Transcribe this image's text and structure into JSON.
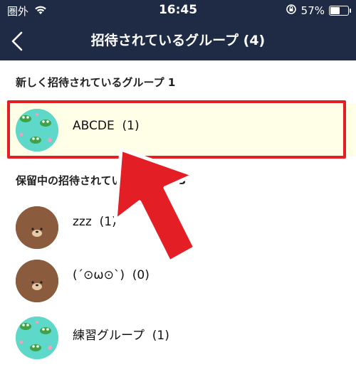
{
  "status_bar": {
    "carrier": "圏外",
    "wifi_icon": "wifi-icon",
    "time": "16:45",
    "rotation_lock_icon": "rotation-lock-icon",
    "battery_percent": "57%",
    "battery_level": 0.57
  },
  "nav": {
    "back_icon": "chevron-left-icon",
    "title": "招待されているグループ (4)"
  },
  "sections": {
    "new_header": "新しく招待されているグループ 1",
    "pending_header": "保留中の招待されているグループ 3"
  },
  "new_groups": [
    {
      "name": "ABCDE  (1)",
      "avatar": "frog"
    }
  ],
  "pending_groups": [
    {
      "name": "zzz  (1)",
      "avatar": "bear"
    },
    {
      "name": "(´⊙ω⊙`)  (0)",
      "avatar": "bear"
    },
    {
      "name": "練習グループ  (1)",
      "avatar": "frog"
    }
  ],
  "colors": {
    "header_bg": "#1f2a44",
    "highlight_border": "#e31e24",
    "highlight_bg": "#fffee6",
    "arrow": "#e31e24"
  }
}
